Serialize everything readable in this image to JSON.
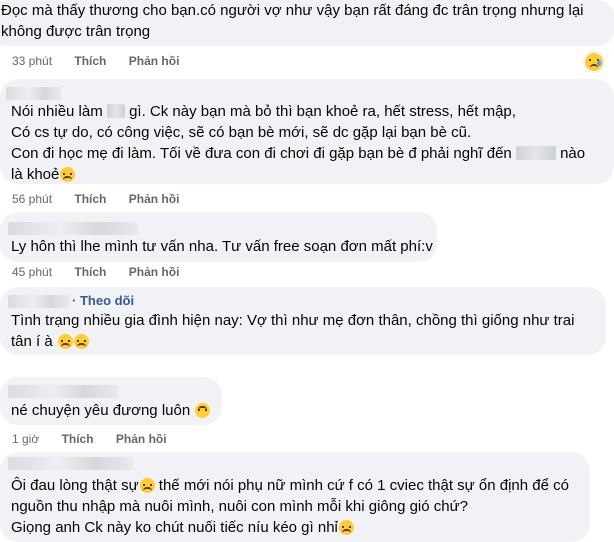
{
  "comments": [
    {
      "lines": [
        "Đọc mà thấy thương cho bạn.có người vợ như vậy bạn rất đáng đc trân trọng nhưng lại",
        "không được trân trọng"
      ],
      "time": "33 phút"
    },
    {
      "line1_a": "Nói nhiều làm",
      "line1_b": "gì. Ck này bạn mà bỏ thì bạn khoẻ ra, hết stress, hết mập,",
      "line2": "Có cs tự do, có công việc, sẽ có bạn bè mới, sẽ dc gặp lại bạn bè cũ.",
      "line3_a": "Con đi học mẹ đi làm. Tối về đưa con đi chơi đi gặp bạn bè đ phải nghĩ đến",
      "line3_b": "nào",
      "line4": "là khoẻ",
      "emoji": "laughing-tears-emoji",
      "time": "56 phút"
    },
    {
      "text": "Ly hôn thì lhe mình tư vấn nha. Tư vấn free soạn đơn mất phí:v",
      "time": "45 phút"
    },
    {
      "follow": "Theo dõi",
      "line1": "Tình trạng nhiều gia đình hiện nay: Vợ thì như mẹ đơn thân, chồng thì giống như trai",
      "line2": "tân í à",
      "emojis": [
        "laughing-tears-emoji",
        "laughing-tears-emoji"
      ]
    },
    {
      "text": "né chuyện yêu đương luôn",
      "emoji": "upside-down-face-emoji",
      "time": "1 giờ"
    },
    {
      "line1_a": "Ôi đau lòng thật sự",
      "line1_b": "thế mới nói phụ nữ mình cứ f có 1 cviec thật sự ổn định để có",
      "line2": "nguồn thu nhập mà nuôi mình, nuôi con mình mỗi khi giông gió chứ?",
      "line3": "Giọng anh Ck này ko chút nuối tiếc níu kéo gì nhỉ",
      "emoji": "sad-face-emoji"
    }
  ],
  "actions": {
    "like": "Thích",
    "reply": "Phản hồi"
  },
  "reaction_icon": "crying-face-reaction-icon"
}
